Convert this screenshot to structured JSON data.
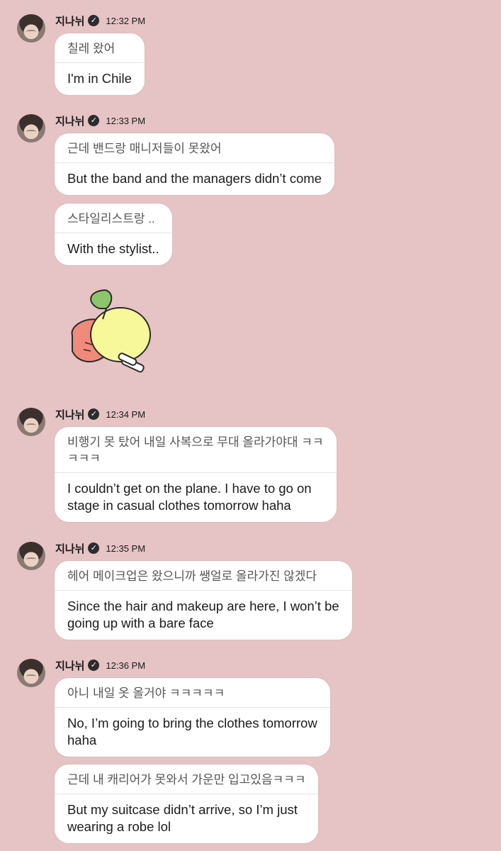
{
  "sender": {
    "name": "지나뉘"
  },
  "groups": [
    {
      "time": "12:32 PM",
      "messages": [
        {
          "ko": "칠레 왔어",
          "en": "I'm in Chile"
        }
      ]
    },
    {
      "time": "12:33 PM",
      "messages": [
        {
          "ko": "근데 밴드랑 매니저들이 못왔어",
          "en": "But the band and the managers didn’t come"
        },
        {
          "ko": "스타일리스트랑 ..",
          "en": "With the stylist.."
        }
      ]
    },
    {
      "time": "12:34 PM",
      "messages": [
        {
          "ko": "비행기 못 탔어 내일 사복으로 무대 올라가야대 ㅋㅋ\nㅋㅋㅋ",
          "en": "I couldn’t get on the plane. I have to go on\nstage in casual clothes tomorrow haha"
        }
      ]
    },
    {
      "time": "12:35 PM",
      "messages": [
        {
          "ko": "헤어 메이크업은 왔으니까 쌩얼로 올라가진 않겠다",
          "en": "Since the hair and makeup are here, I won’t be\ngoing up with a bare face"
        }
      ]
    },
    {
      "time": "12:36 PM",
      "messages": [
        {
          "ko": "아니 내일 옷 올거야 ㅋㅋㅋㅋㅋ",
          "en": "No, I’m going to bring the clothes tomorrow\nhaha"
        },
        {
          "ko": "근데 내 캐리어가 못와서 가운만 입고있음ㅋㅋㅋ",
          "en": "But my suitcase didn’t arrive, so I’m just\nwearing a robe lol"
        }
      ]
    }
  ],
  "colors": {
    "background": "#e6c3c4",
    "bubble": "#ffffff"
  }
}
